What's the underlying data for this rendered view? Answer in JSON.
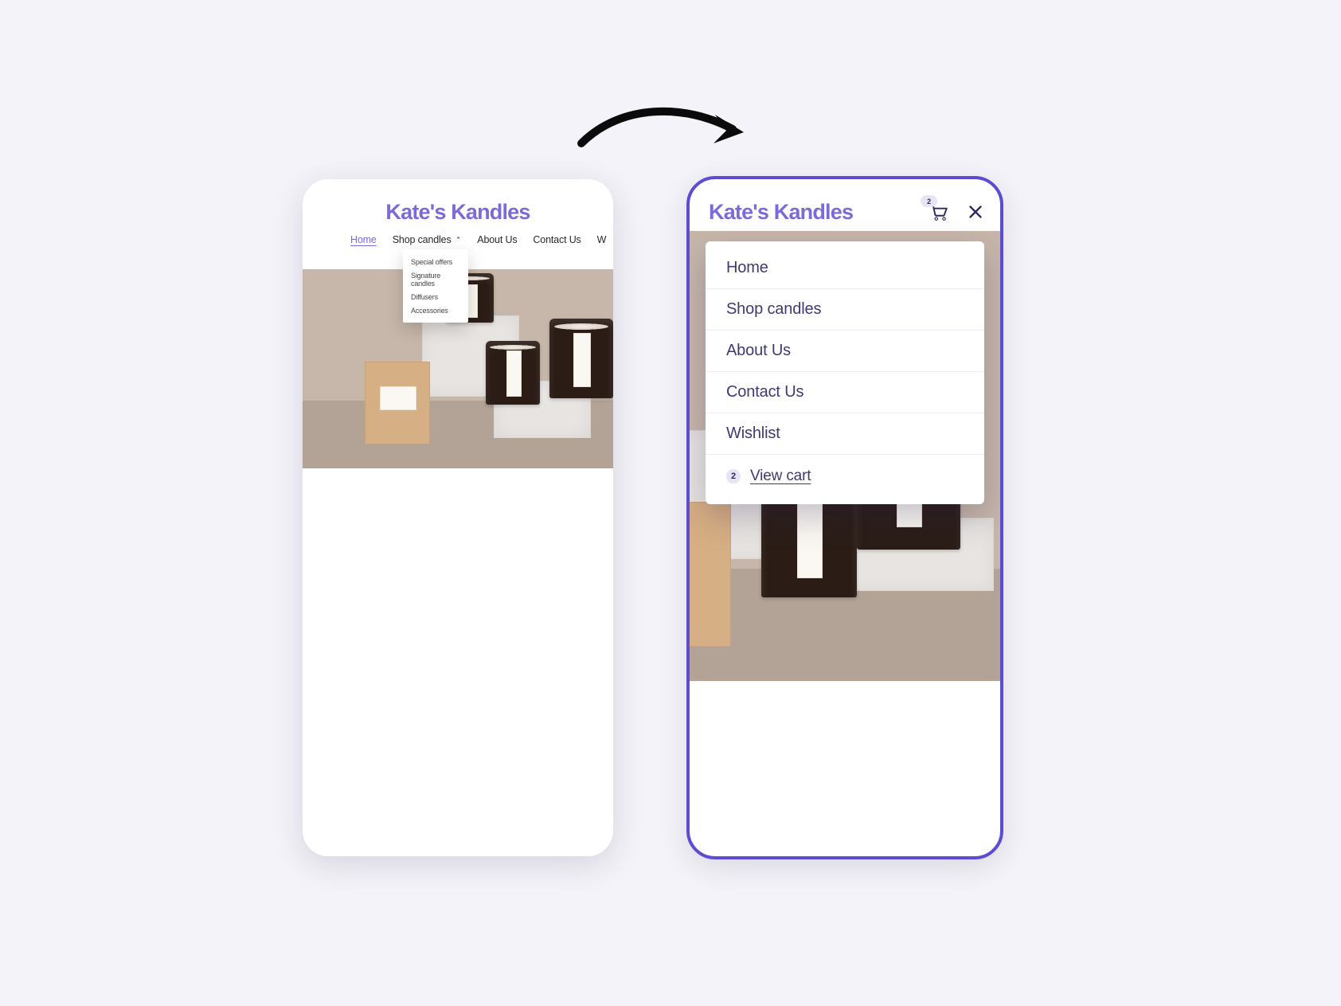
{
  "brand_name": "Kate's Kandles",
  "cart_count": "2",
  "left_device": {
    "nav": {
      "home": "Home",
      "shop": "Shop candles",
      "about": "About Us",
      "contact": "Contact Us",
      "wishlist_first_letter": "W"
    },
    "dropdown": {
      "special_offers": "Special offers",
      "signature": "Signature candles",
      "diffusers": "Diffusers",
      "accessories": "Accessories"
    }
  },
  "right_device": {
    "menu": {
      "home": "Home",
      "shop": "Shop candles",
      "about": "About Us",
      "contact": "Contact Us",
      "wishlist": "Wishlist",
      "view_cart": "View cart"
    }
  }
}
